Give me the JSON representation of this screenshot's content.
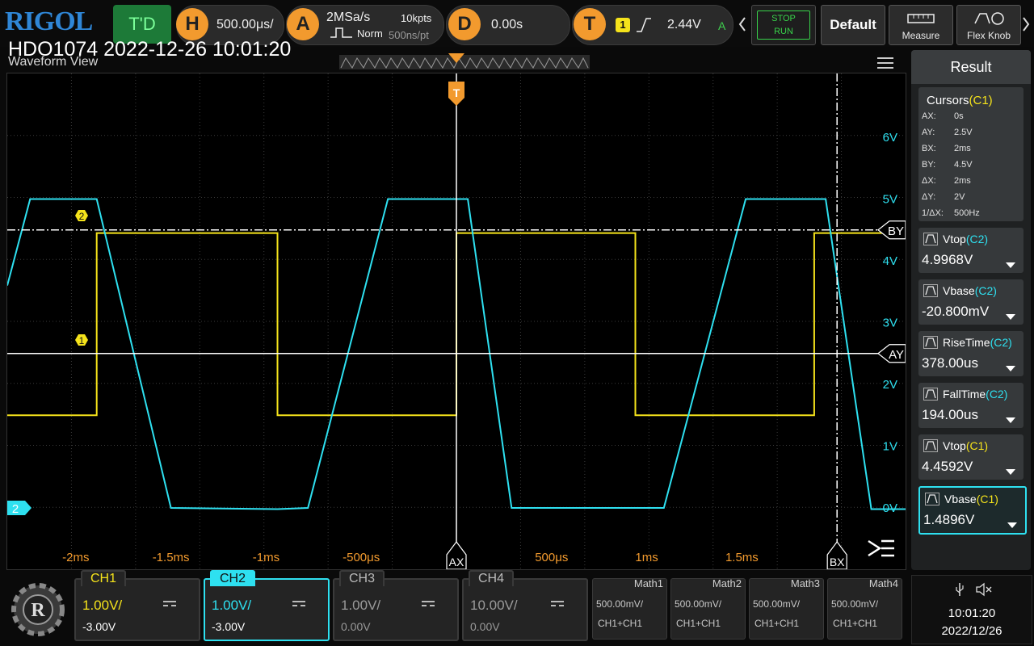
{
  "top_bar": {
    "brand": "RIGOL",
    "header_title": "HDO1074 2022-12-26 10:01:20",
    "run_state": "T'D",
    "horizontal": {
      "key": "H",
      "timebase": "500.00μs/"
    },
    "acquire": {
      "key": "A",
      "sample_rate": "2MSa/s",
      "memory_depth": "10kpts",
      "mode": "Norm",
      "time_per_point": "500ns/pt"
    },
    "delay": {
      "key": "D",
      "value": "0.00s"
    },
    "trigger": {
      "key": "T",
      "source": "1",
      "level": "2.44V",
      "mode": "A"
    },
    "stop_run": {
      "line1": "STOP",
      "line2": "RUN"
    },
    "default_button": {
      "label": "Default"
    },
    "measure_button": {
      "label": "Measure"
    },
    "flex_knob_button": {
      "label": "Flex Knob"
    }
  },
  "waveform_view": {
    "title": "Waveform View",
    "x_tick_labels": [
      "-2ms",
      "-1.5ms",
      "-1ms",
      "-500μs",
      "500μs",
      "1ms",
      "1.5ms"
    ],
    "y_tick_labels": [
      "6V",
      "5V",
      "4V",
      "3V",
      "2V",
      "1V",
      "0V"
    ],
    "cursor_labels": {
      "ax": "AX",
      "bx": "BX",
      "ay": "AY",
      "by": "BY"
    },
    "channel_markers": {
      "ch1": "1",
      "ch2": "2",
      "ch2_ref": "2"
    }
  },
  "result_panel": {
    "title": "Result",
    "cursors": {
      "title": "Cursors",
      "source": "(C1)",
      "rows": [
        {
          "label": "AX:",
          "value": "0s"
        },
        {
          "label": "AY:",
          "value": "2.5V"
        },
        {
          "label": "BX:",
          "value": "2ms"
        },
        {
          "label": "BY:",
          "value": "4.5V"
        },
        {
          "label": "ΔX:",
          "value": "2ms"
        },
        {
          "label": "ΔY:",
          "value": "2V"
        },
        {
          "label": "1/ΔX:",
          "value": "500Hz"
        }
      ]
    },
    "measurements": [
      {
        "name": "Vtop",
        "source": "(C2)",
        "value": "4.9968V"
      },
      {
        "name": "Vbase",
        "source": "(C2)",
        "value": "-20.800mV"
      },
      {
        "name": "RiseTime",
        "source": "(C2)",
        "value": "378.00us"
      },
      {
        "name": "FallTime",
        "source": "(C2)",
        "value": "194.00us"
      },
      {
        "name": "Vtop",
        "source": "(C1)",
        "value": "4.4592V"
      },
      {
        "name": "Vbase",
        "source": "(C1)",
        "value": "1.4896V"
      }
    ]
  },
  "channels": [
    {
      "name": "CH1",
      "scale": "1.00V/",
      "offset": "-3.00V",
      "color": "#f5e31b"
    },
    {
      "name": "CH2",
      "scale": "1.00V/",
      "offset": "-3.00V",
      "color": "#2ee0f0"
    },
    {
      "name": "CH3",
      "scale": "1.00V/",
      "offset": "0.00V",
      "color": "#8a8a8a"
    },
    {
      "name": "CH4",
      "scale": "10.00V/",
      "offset": "0.00V",
      "color": "#8a8a8a"
    }
  ],
  "maths": [
    {
      "name": "Math1",
      "scale": "500.00mV/",
      "source": "CH1+CH1"
    },
    {
      "name": "Math2",
      "scale": "500.00mV/",
      "source": "CH1+CH1"
    },
    {
      "name": "Math3",
      "scale": "500.00mV/",
      "source": "CH1+CH1"
    },
    {
      "name": "Math4",
      "scale": "500.00mV/",
      "source": "CH1+CH1"
    }
  ],
  "clock": {
    "time": "10:01:20",
    "date": "2022/12/26"
  },
  "colors": {
    "ch1": "#f5e31b",
    "ch2": "#2ee0f0",
    "accent": "#f29a2e",
    "run_green": "#38d24a"
  },
  "chart_data": {
    "type": "line",
    "x_unit": "s",
    "y_unit": "V",
    "xlim": [
      -0.00236,
      0.00236
    ],
    "ylim": [
      -0.0,
      7.0
    ],
    "series": [
      {
        "name": "CH1",
        "x": [
          -0.00236,
          -0.00189,
          -0.00189,
          -0.00094,
          -0.00094,
          0.0,
          0.0,
          0.00094,
          0.00094,
          0.00188,
          0.00188,
          0.00236
        ],
        "y": [
          1.5,
          1.5,
          4.45,
          4.45,
          1.5,
          1.5,
          4.45,
          4.45,
          1.5,
          1.5,
          4.45,
          4.45
        ]
      },
      {
        "name": "CH2",
        "x": [
          -0.00236,
          -0.00224,
          -0.00189,
          -0.0015,
          -0.00094,
          -0.00078,
          -0.00036,
          6e-05,
          0.00029,
          0.00109,
          0.00152,
          0.00194,
          0.00218,
          0.00236
        ],
        "y": [
          3.6,
          5.0,
          5.0,
          0.0,
          -0.02,
          0.0,
          5.0,
          5.0,
          0.0,
          0.0,
          5.0,
          5.0,
          -0.02,
          -0.02
        ]
      }
    ]
  }
}
